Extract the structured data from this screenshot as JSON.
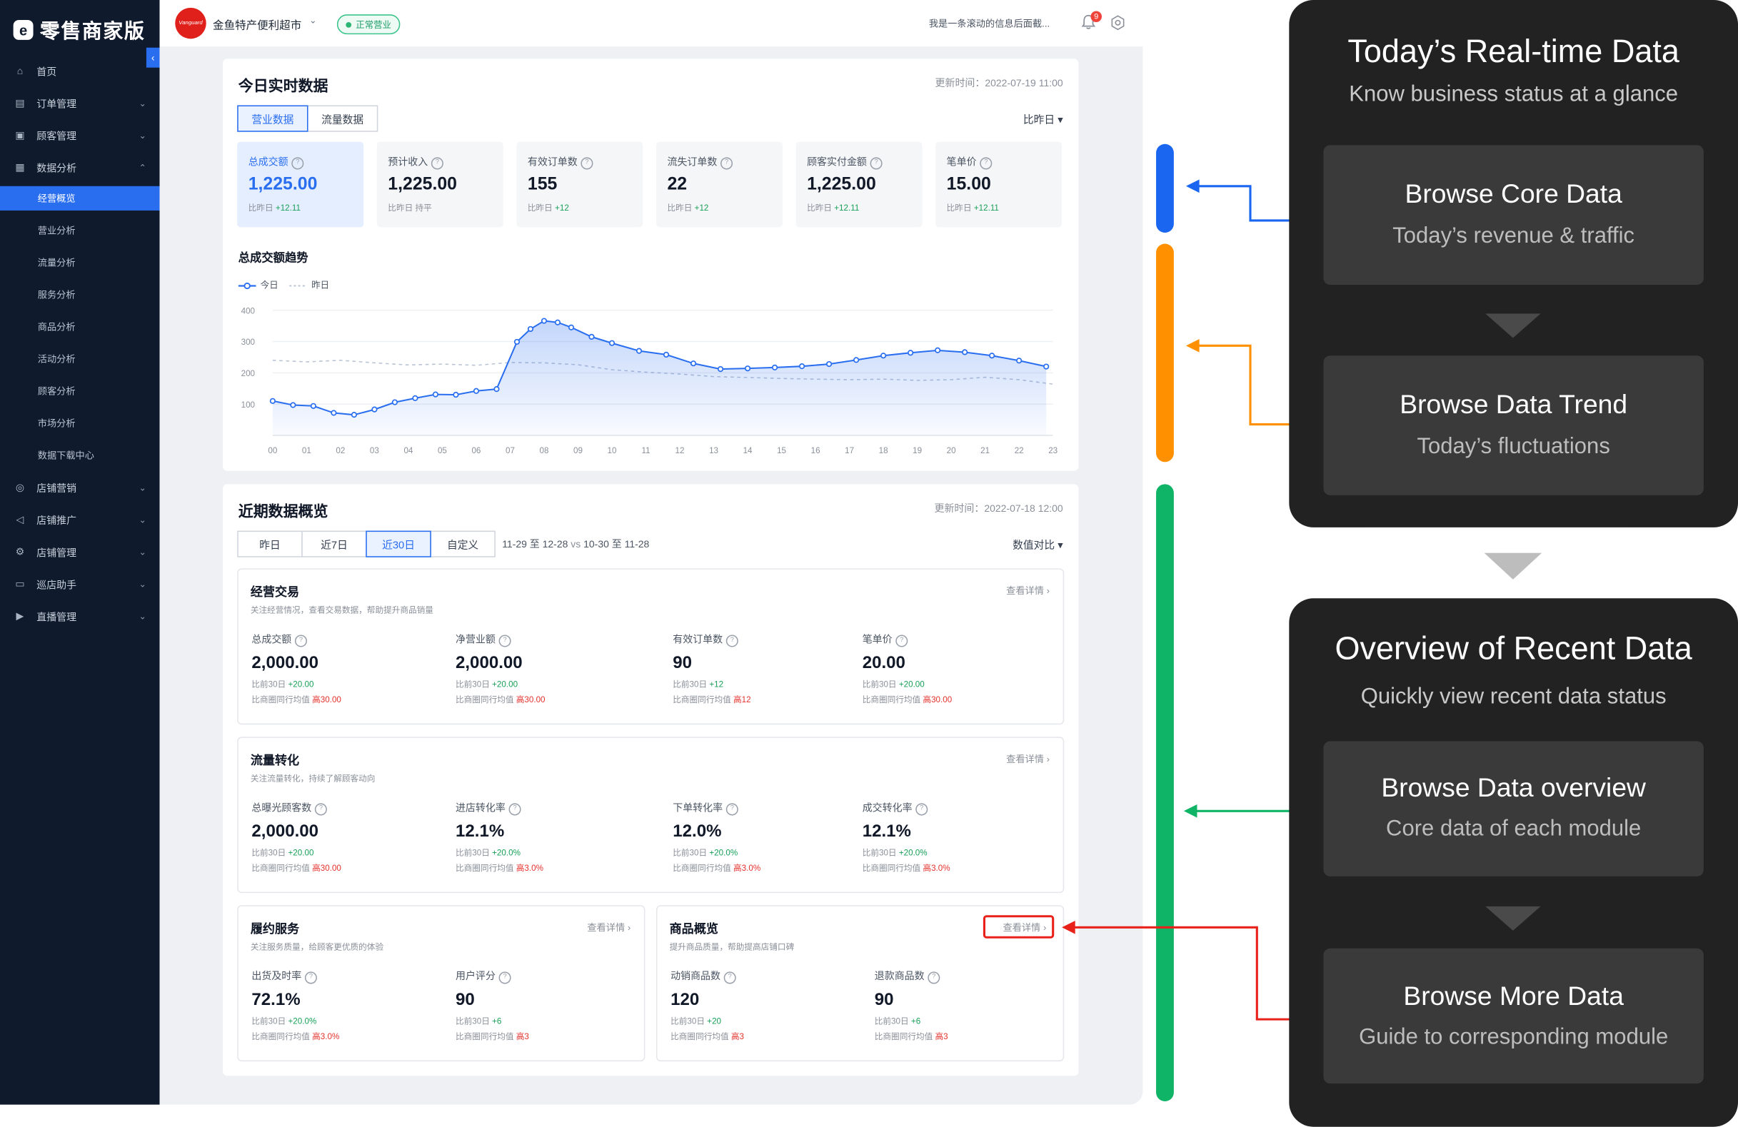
{
  "app": {
    "logo_text": "零售商家版"
  },
  "sidebar": {
    "items": [
      {
        "label": "首页",
        "icon": "home-icon"
      },
      {
        "label": "订单管理",
        "icon": "order-icon"
      },
      {
        "label": "顾客管理",
        "icon": "customer-icon"
      },
      {
        "label": "数据分析",
        "icon": "analytics-icon"
      }
    ],
    "sub_items": [
      "经营概览",
      "营业分析",
      "流量分析",
      "服务分析",
      "商品分析",
      "活动分析",
      "顾客分析",
      "市场分析",
      "数据下载中心"
    ],
    "items_bottom": [
      {
        "label": "店铺营销",
        "icon": "marketing-icon"
      },
      {
        "label": "店铺推广",
        "icon": "megaphone-icon"
      },
      {
        "label": "店铺管理",
        "icon": "store-settings-icon"
      },
      {
        "label": "巡店助手",
        "icon": "inspection-icon"
      },
      {
        "label": "直播管理",
        "icon": "live-icon"
      }
    ]
  },
  "topbar": {
    "shop_logo_text": "Vanguard",
    "shop_name": "金鱼特产便利超市",
    "status": "正常营业",
    "marquee": "我是一条滚动的信息后面截...",
    "notification_count": "9",
    "colors": {
      "status": "#2bb673",
      "badge": "#f0443a"
    }
  },
  "realtime": {
    "title": "今日实时数据",
    "updated": "更新时间：2022-07-19 11:00",
    "tabs": [
      "营业数据",
      "流量数据"
    ],
    "compare_select": "比昨日",
    "kpis": [
      {
        "label": "总成交额",
        "value": "1,225.00",
        "cmp_label": "比昨日",
        "cmp": "+12.11"
      },
      {
        "label": "预计收入",
        "value": "1,225.00",
        "cmp_label": "比昨日",
        "cmp": "持平"
      },
      {
        "label": "有效订单数",
        "value": "155",
        "cmp_label": "比昨日",
        "cmp": "+12"
      },
      {
        "label": "流失订单数",
        "value": "22",
        "cmp_label": "比昨日",
        "cmp": "+12"
      },
      {
        "label": "顾客实付金额",
        "value": "1,225.00",
        "cmp_label": "比昨日",
        "cmp": "+12.11"
      },
      {
        "label": "笔单价",
        "value": "15.00",
        "cmp_label": "比昨日",
        "cmp": "+12.11"
      }
    ],
    "chart_title": "总成交额趋势",
    "legend_today": "今日",
    "legend_yesterday": "昨日"
  },
  "chart_data": {
    "type": "line",
    "title": "总成交额趋势",
    "xlabel": "",
    "ylabel": "",
    "x": [
      "00",
      "01",
      "02",
      "03",
      "04",
      "05",
      "06",
      "07",
      "08",
      "09",
      "10",
      "11",
      "12",
      "13",
      "14",
      "15",
      "16",
      "17",
      "18",
      "19",
      "20",
      "21",
      "22",
      "23"
    ],
    "yticks": [
      100,
      200,
      300,
      400
    ],
    "ylim": [
      0,
      400
    ],
    "grid": true,
    "legend_position": "top-left",
    "series": [
      {
        "name": "今日",
        "style": "solid",
        "color": "#2a6ef0",
        "points": [
          [
            0,
            110
          ],
          [
            0.6,
            97
          ],
          [
            1.2,
            94
          ],
          [
            1.8,
            72
          ],
          [
            2.4,
            66
          ],
          [
            3,
            83
          ],
          [
            3.6,
            106
          ],
          [
            4.2,
            119
          ],
          [
            4.8,
            131
          ],
          [
            5.4,
            130
          ],
          [
            6,
            142
          ],
          [
            6.6,
            148
          ],
          [
            7.2,
            299
          ],
          [
            7.6,
            340
          ],
          [
            8,
            366
          ],
          [
            8.4,
            361
          ],
          [
            8.8,
            345
          ],
          [
            9.4,
            315
          ],
          [
            10,
            295
          ],
          [
            10.8,
            270
          ],
          [
            11.6,
            258
          ],
          [
            12.4,
            230
          ],
          [
            13.2,
            212
          ],
          [
            14,
            214
          ],
          [
            14.8,
            217
          ],
          [
            15.6,
            221
          ],
          [
            16.4,
            228
          ],
          [
            17.2,
            241
          ],
          [
            18,
            255
          ],
          [
            18.8,
            264
          ],
          [
            19.6,
            272
          ],
          [
            20.4,
            266
          ],
          [
            21.2,
            255
          ],
          [
            22,
            239
          ],
          [
            22.8,
            220
          ]
        ]
      },
      {
        "name": "昨日",
        "style": "dashed",
        "color": "#b9c3d3",
        "values": [
          240,
          235,
          240,
          232,
          225,
          228,
          224,
          233,
          232,
          226,
          210,
          202,
          196,
          188,
          185,
          182,
          180,
          178,
          180,
          176,
          178,
          186,
          178,
          164
        ]
      }
    ]
  },
  "recent": {
    "title": "近期数据概览",
    "updated": "更新时间：2022-07-18 12:00",
    "ranges": [
      "昨日",
      "近7日",
      "近30日",
      "自定义"
    ],
    "date_range": "11-29 至 12-28",
    "vs": "vs",
    "date_range_compare": "10-30 至 11-28",
    "compare_select": "数值对比",
    "modules": {
      "operation": {
        "title": "经营交易",
        "subtitle": "关注经营情况，查看交易数据，帮助提升商品销量",
        "link": "查看详情",
        "metrics": [
          {
            "label": "总成交额",
            "value": "2,000.00",
            "cmp_label": "比前30日",
            "cmp": "+20.00",
            "peer_label": "比商圈同行均值",
            "peer": "高30.00"
          },
          {
            "label": "净营业额",
            "value": "2,000.00",
            "cmp_label": "比前30日",
            "cmp": "+20.00",
            "peer_label": "比商圈同行均值",
            "peer": "高30.00"
          },
          {
            "label": "有效订单数",
            "value": "90",
            "cmp_label": "比前30日",
            "cmp": "+12",
            "peer_label": "比商圈同行均值",
            "peer": "高12"
          },
          {
            "label": "笔单价",
            "value": "20.00",
            "cmp_label": "比前30日",
            "cmp": "+20.00",
            "peer_label": "比商圈同行均值",
            "peer": "高30.00"
          }
        ]
      },
      "traffic": {
        "title": "流量转化",
        "subtitle": "关注流量转化，持续了解顾客动向",
        "link": "查看详情",
        "metrics": [
          {
            "label": "总曝光顾客数",
            "value": "2,000.00",
            "cmp_label": "比前30日",
            "cmp": "+20.00",
            "peer_label": "比商圈同行均值",
            "peer": "高30.00"
          },
          {
            "label": "进店转化率",
            "value": "12.1%",
            "cmp_label": "比前30日",
            "cmp": "+20.0%",
            "peer_label": "比商圈同行均值",
            "peer": "高3.0%"
          },
          {
            "label": "下单转化率",
            "value": "12.0%",
            "cmp_label": "比前30日",
            "cmp": "+20.0%",
            "peer_label": "比商圈同行均值",
            "peer": "高3.0%"
          },
          {
            "label": "成交转化率",
            "value": "12.1%",
            "cmp_label": "比前30日",
            "cmp": "+20.0%",
            "peer_label": "比商圈同行均值",
            "peer": "高3.0%"
          }
        ]
      },
      "fulfillment": {
        "title": "履约服务",
        "subtitle": "关注服务质量，给顾客更优质的体验",
        "link": "查看详情",
        "metrics": [
          {
            "label": "出货及时率",
            "value": "72.1%",
            "cmp_label": "比前30日",
            "cmp": "+20.0%",
            "peer_label": "比商圈同行均值",
            "peer": "高3.0%"
          },
          {
            "label": "用户评分",
            "value": "90",
            "cmp_label": "比前30日",
            "cmp": "+6",
            "peer_label": "比商圈同行均值",
            "peer": "高3"
          }
        ]
      },
      "goods": {
        "title": "商品概览",
        "subtitle": "提升商品质量，帮助提高店铺口碑",
        "link": "查看详情",
        "metrics": [
          {
            "label": "动销商品数",
            "value": "120",
            "cmp_label": "比前30日",
            "cmp": "+20",
            "peer_label": "比商圈同行均值",
            "peer": "高3"
          },
          {
            "label": "退款商品数",
            "value": "90",
            "cmp_label": "比前30日",
            "cmp": "+6",
            "peer_label": "比商圈同行均值",
            "peer": "高3"
          }
        ]
      }
    }
  },
  "annotations": {
    "realtime_panel": {
      "title": "Today’s Real-time Data",
      "subtitle": "Know business status at a glance",
      "boxes": [
        {
          "title": "Browse Core Data",
          "subtitle": "Today’s revenue & traffic"
        },
        {
          "title": "Browse Data Trend",
          "subtitle": "Today’s fluctuations"
        }
      ]
    },
    "recent_panel": {
      "title": "Overview of Recent Data",
      "subtitle": "Quickly view recent data status",
      "boxes": [
        {
          "title": "Browse Data overview",
          "subtitle": "Core data of each module"
        },
        {
          "title": "Browse More Data",
          "subtitle": "Guide to corresponding module"
        }
      ]
    },
    "colors": {
      "blue": "#1a66f0",
      "orange": "#ff9100",
      "green": "#10b466",
      "red": "#e8221b"
    }
  }
}
